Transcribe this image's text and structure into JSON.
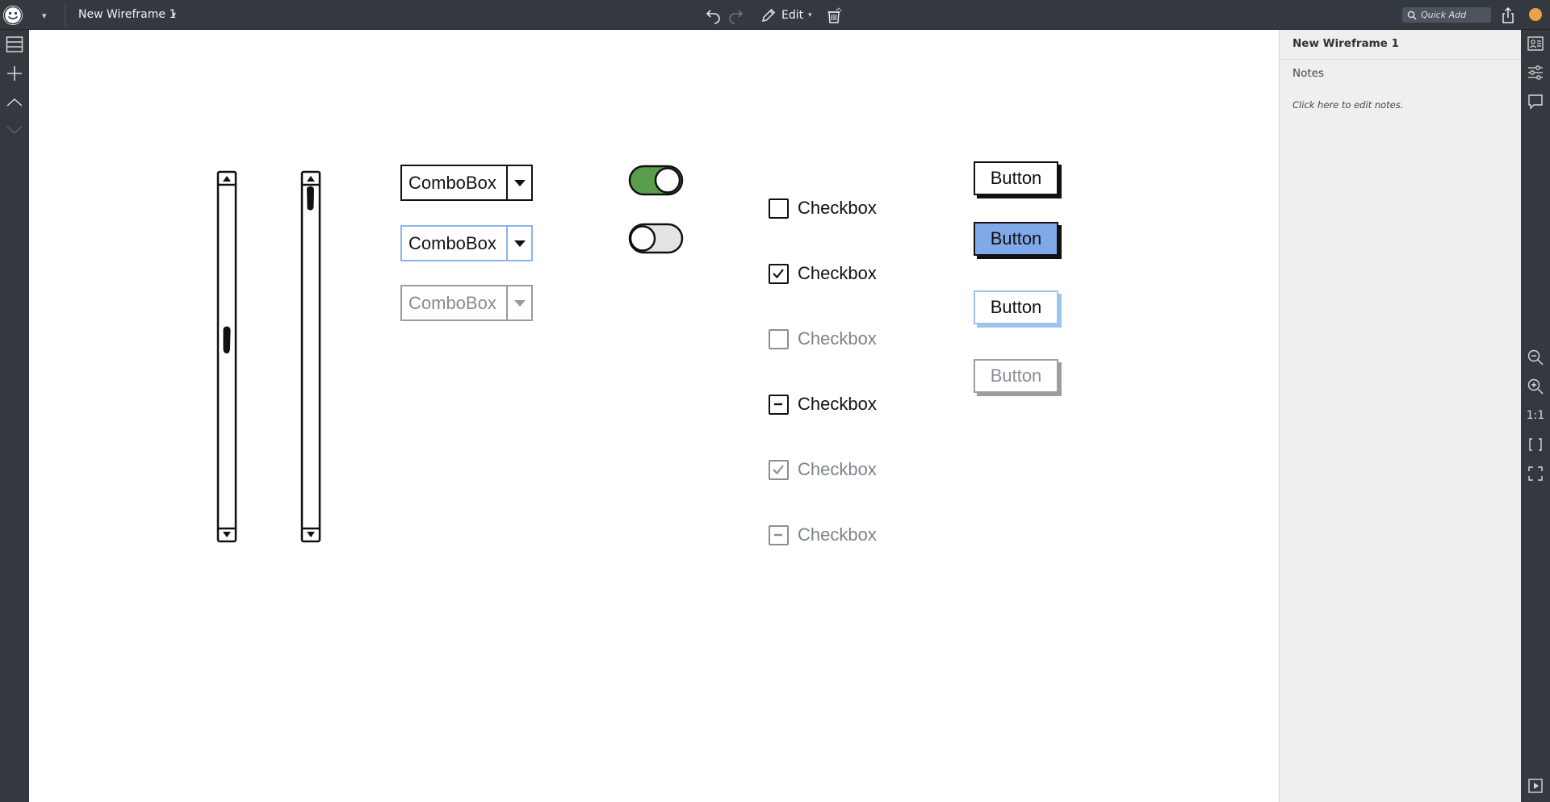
{
  "app": {
    "title": "New Wireframe 1",
    "edit_label": "Edit",
    "quick_add_placeholder": "Quick Add"
  },
  "right_panel": {
    "title": "New Wireframe 1",
    "notes_label": "Notes",
    "notes_hint": "Click here to edit notes.",
    "zoom_actual_label": "1:1"
  },
  "wireframe": {
    "comboboxes": [
      {
        "label": "ComboBox",
        "state": "normal"
      },
      {
        "label": "ComboBox",
        "state": "focused"
      },
      {
        "label": "ComboBox",
        "state": "disabled"
      }
    ],
    "switches": [
      {
        "on": true,
        "color": "#5a9e4b"
      },
      {
        "on": false,
        "color": "#e4e4e4"
      }
    ],
    "checkboxes": [
      {
        "label": "Checkbox",
        "state": "unchecked",
        "disabled": false
      },
      {
        "label": "Checkbox",
        "state": "checked",
        "disabled": false
      },
      {
        "label": "Checkbox",
        "state": "unchecked",
        "disabled": true
      },
      {
        "label": "Checkbox",
        "state": "indeterminate",
        "disabled": false
      },
      {
        "label": "Checkbox",
        "state": "checked",
        "disabled": true
      },
      {
        "label": "Checkbox",
        "state": "indeterminate",
        "disabled": true
      }
    ],
    "buttons": [
      {
        "label": "Button",
        "state": "normal"
      },
      {
        "label": "Button",
        "state": "selected",
        "color": "#7fa9e8"
      },
      {
        "label": "Button",
        "state": "focused",
        "color": "#9fc2f0"
      },
      {
        "label": "Button",
        "state": "disabled"
      }
    ],
    "scrollbars": [
      {
        "orientation": "vertical",
        "thumb_position": 0.45
      },
      {
        "orientation": "vertical",
        "thumb_position": 0.0
      }
    ]
  },
  "colors": {
    "chrome": "#33393f",
    "canvas": "#ffffff",
    "panel": "#efefef",
    "focus": "#8ab4ea"
  }
}
